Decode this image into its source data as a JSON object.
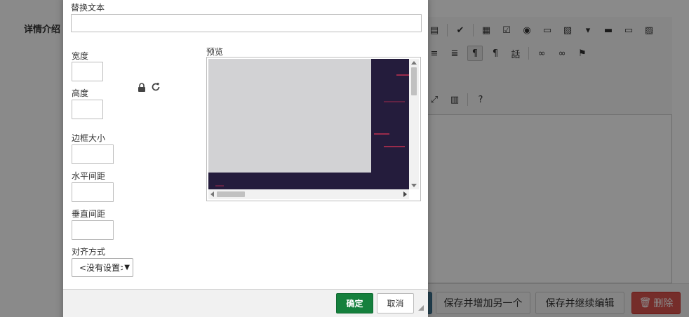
{
  "background": {
    "section_label": "详情介绍",
    "buttons": {
      "save_add_another": "保存并增加另一个",
      "save_continue": "保存并继续编辑",
      "delete": "删除"
    }
  },
  "dialog": {
    "alt_text": {
      "label": "替换文本",
      "value": ""
    },
    "width": {
      "label": "宽度",
      "value": ""
    },
    "height": {
      "label": "高度",
      "value": ""
    },
    "border": {
      "label": "边框大小",
      "value": ""
    },
    "hspace": {
      "label": "水平间距",
      "value": ""
    },
    "vspace": {
      "label": "垂直间距",
      "value": ""
    },
    "align": {
      "label": "对齐方式",
      "selected": "<没有设置>"
    },
    "preview_label": "预览",
    "ok_label": "确定",
    "cancel_label": "取消"
  },
  "icons": {
    "lock": "lock-icon",
    "reset": "reset-size-icon",
    "delete": "trash-icon"
  },
  "colors": {
    "ok_button": "#15803d",
    "delete_button": "#d9534f",
    "preview_dark": "#241c3c"
  }
}
